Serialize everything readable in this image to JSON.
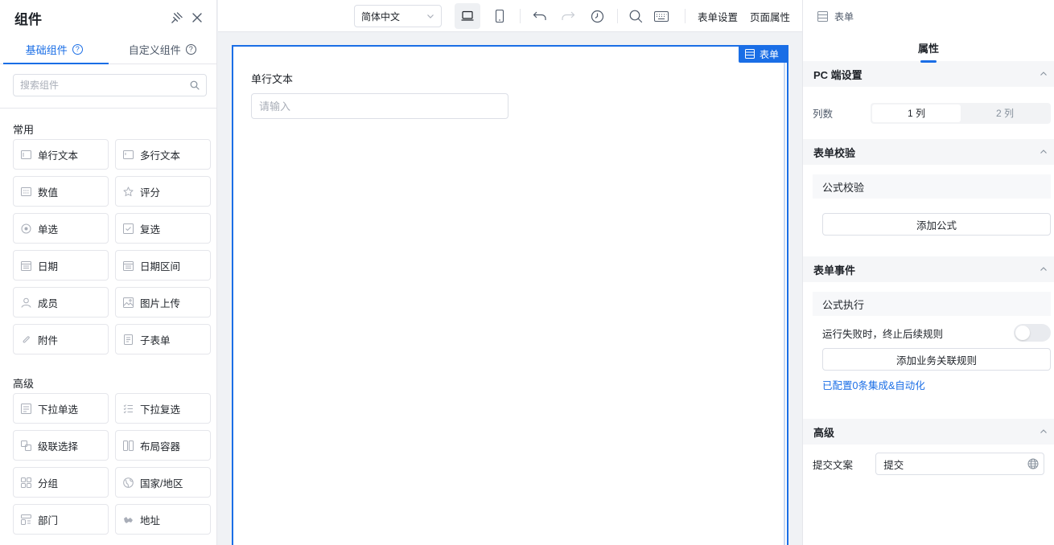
{
  "left": {
    "title": "组件",
    "tabs": [
      {
        "label": "基础组件",
        "active": true
      },
      {
        "label": "自定义组件",
        "active": false
      }
    ],
    "help_symbol": "?",
    "search_placeholder": "搜索组件",
    "groups": [
      {
        "title": "常用",
        "items": [
          {
            "label": "单行文本",
            "icon": "single-line-text-icon"
          },
          {
            "label": "多行文本",
            "icon": "multi-line-text-icon"
          },
          {
            "label": "数值",
            "icon": "number-icon"
          },
          {
            "label": "评分",
            "icon": "star-icon"
          },
          {
            "label": "单选",
            "icon": "radio-icon"
          },
          {
            "label": "复选",
            "icon": "checkbox-icon"
          },
          {
            "label": "日期",
            "icon": "calendar-icon"
          },
          {
            "label": "日期区间",
            "icon": "calendar-range-icon"
          },
          {
            "label": "成员",
            "icon": "user-icon"
          },
          {
            "label": "图片上传",
            "icon": "image-icon"
          },
          {
            "label": "附件",
            "icon": "paperclip-icon"
          },
          {
            "label": "子表单",
            "icon": "subform-icon"
          }
        ]
      },
      {
        "title": "高级",
        "items": [
          {
            "label": "下拉单选",
            "icon": "dropdown-single-icon"
          },
          {
            "label": "下拉复选",
            "icon": "dropdown-multi-icon"
          },
          {
            "label": "级联选择",
            "icon": "cascade-icon"
          },
          {
            "label": "布局容器",
            "icon": "layout-icon"
          },
          {
            "label": "分组",
            "icon": "group-icon"
          },
          {
            "label": "国家/地区",
            "icon": "globe-icon"
          },
          {
            "label": "部门",
            "icon": "department-icon"
          },
          {
            "label": "地址",
            "icon": "address-icon"
          }
        ]
      }
    ]
  },
  "toolbar": {
    "language": "简体中文",
    "form_settings": "表单设置",
    "page_properties": "页面属性"
  },
  "canvas": {
    "badge": "表单",
    "field_label": "单行文本",
    "field_placeholder": "请输入"
  },
  "right": {
    "header": "表单",
    "tab": "属性",
    "pc_settings": {
      "title": "PC 端设置",
      "columns_label": "列数",
      "options": [
        "1 列",
        "2 列"
      ],
      "selected": "1 列"
    },
    "validation": {
      "title": "表单校验",
      "sub_title": "公式校验",
      "add_button": "添加公式"
    },
    "events": {
      "title": "表单事件",
      "sub_title": "公式执行",
      "toggle_label": "运行失败时，终止后续规则",
      "toggle_on": false,
      "add_rule_button": "添加业务关联规则",
      "link": "已配置0条集成&自动化"
    },
    "advanced": {
      "title": "高级",
      "submit_label": "提交文案",
      "submit_value": "提交"
    }
  },
  "colors": {
    "accent": "#1a6ee6",
    "border": "#e5e6eb",
    "text": "#1f2329"
  }
}
